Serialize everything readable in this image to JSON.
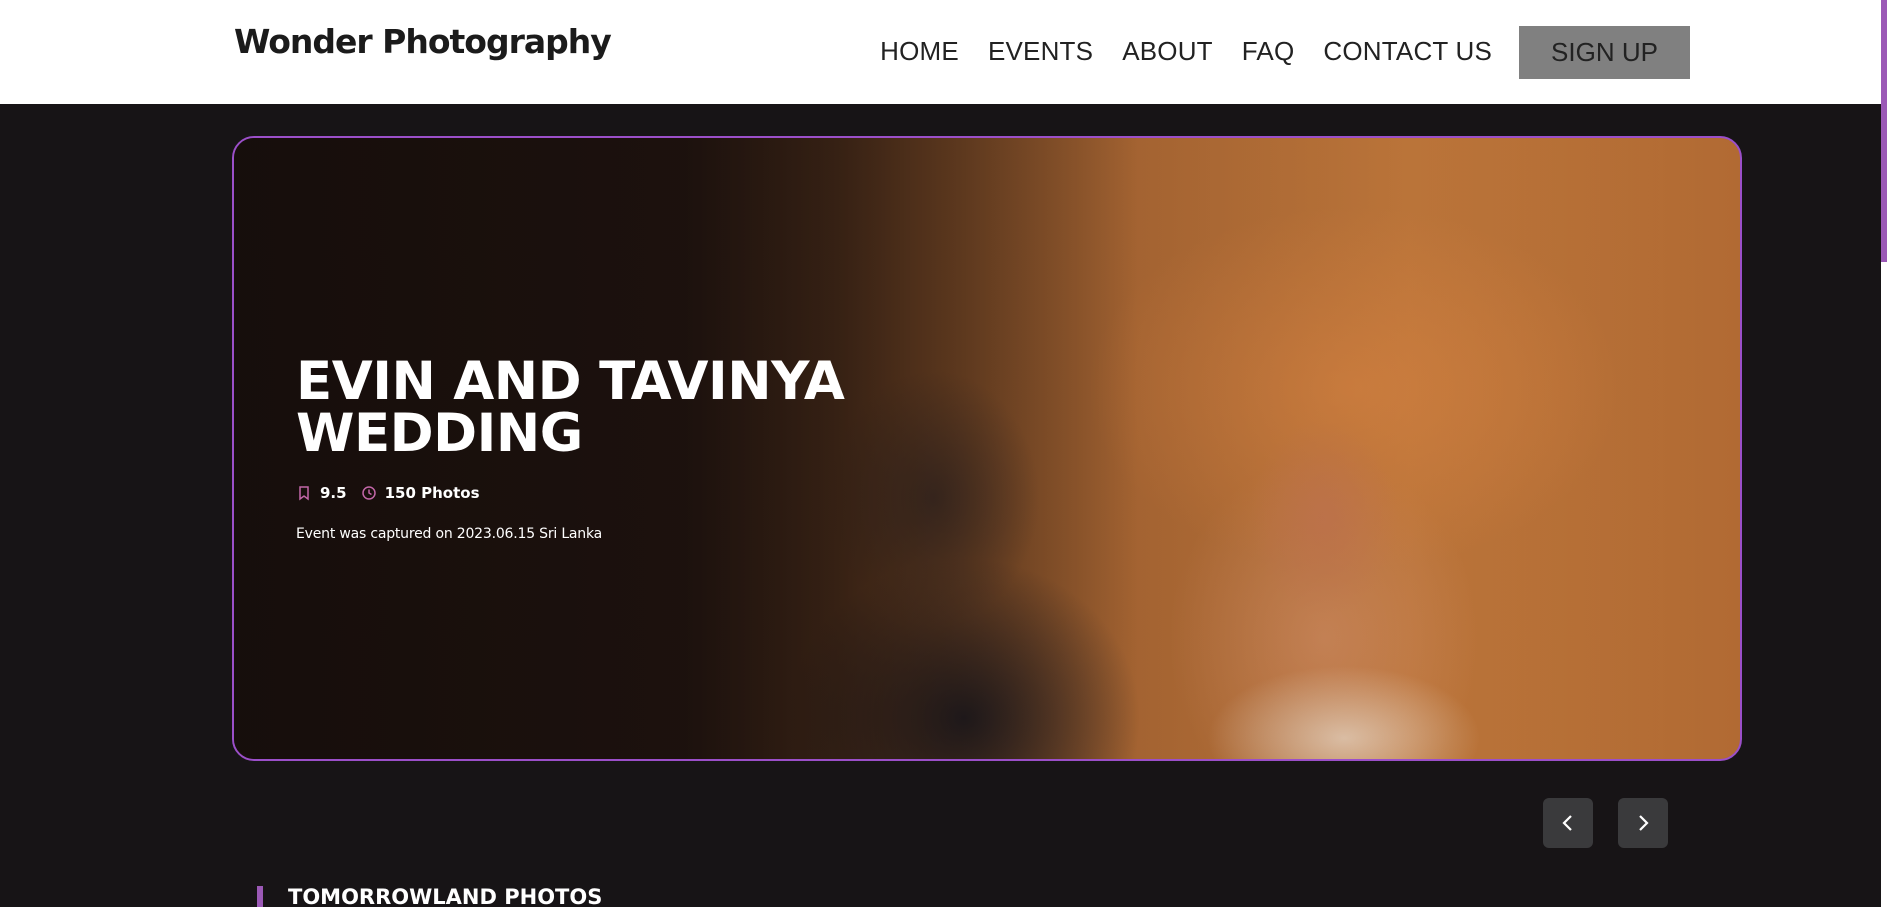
{
  "header": {
    "logo": "Wonder Photography",
    "nav": [
      {
        "label": "HOME"
      },
      {
        "label": "EVENTS"
      },
      {
        "label": "ABOUT"
      },
      {
        "label": "FAQ"
      },
      {
        "label": "CONTACT US"
      }
    ],
    "signup_label": "SIGN UP"
  },
  "hero": {
    "title": "EVIN AND TAVINYA WEDDING",
    "rating": "9.5",
    "rating_icon": "bookmark-icon",
    "photos": "150 Photos",
    "photos_icon": "clock-icon",
    "caption": "Event was captured on 2023.06.15 Sri Lanka"
  },
  "slider": {
    "prev_icon": "chevron-left-icon",
    "next_icon": "chevron-right-icon"
  },
  "section": {
    "title": "TOMORROWLAND PHOTOS"
  },
  "colors": {
    "accent": "#9b59b6",
    "header_bg": "#ffffff",
    "page_bg": "#171416",
    "signup_bg": "#808080"
  }
}
